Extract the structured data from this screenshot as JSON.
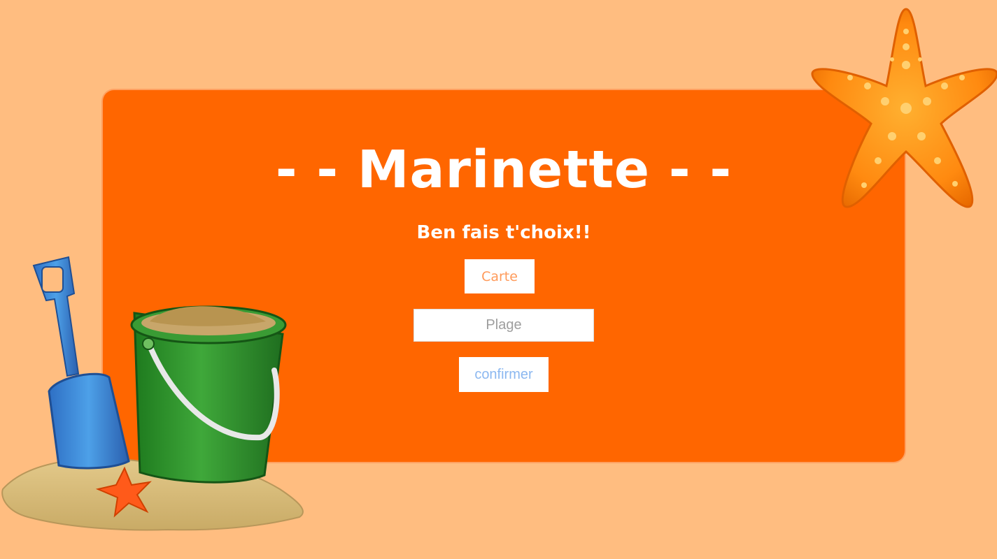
{
  "page": {
    "title": "- - Marinette - -",
    "subtitle": "Ben fais t'choix!!"
  },
  "form": {
    "carte_button_label": "Carte",
    "plage_placeholder": "Plage",
    "plage_value": "",
    "confirm_button_label": "confirmer"
  },
  "icons": {
    "starfish": "starfish-icon",
    "bucket_scene": "sand-bucket-shovel-icon"
  },
  "colors": {
    "background": "#ffbd80",
    "card": "#ff6600",
    "carte_text": "#ff9a5a",
    "confirm_text": "#8cb8f0"
  }
}
